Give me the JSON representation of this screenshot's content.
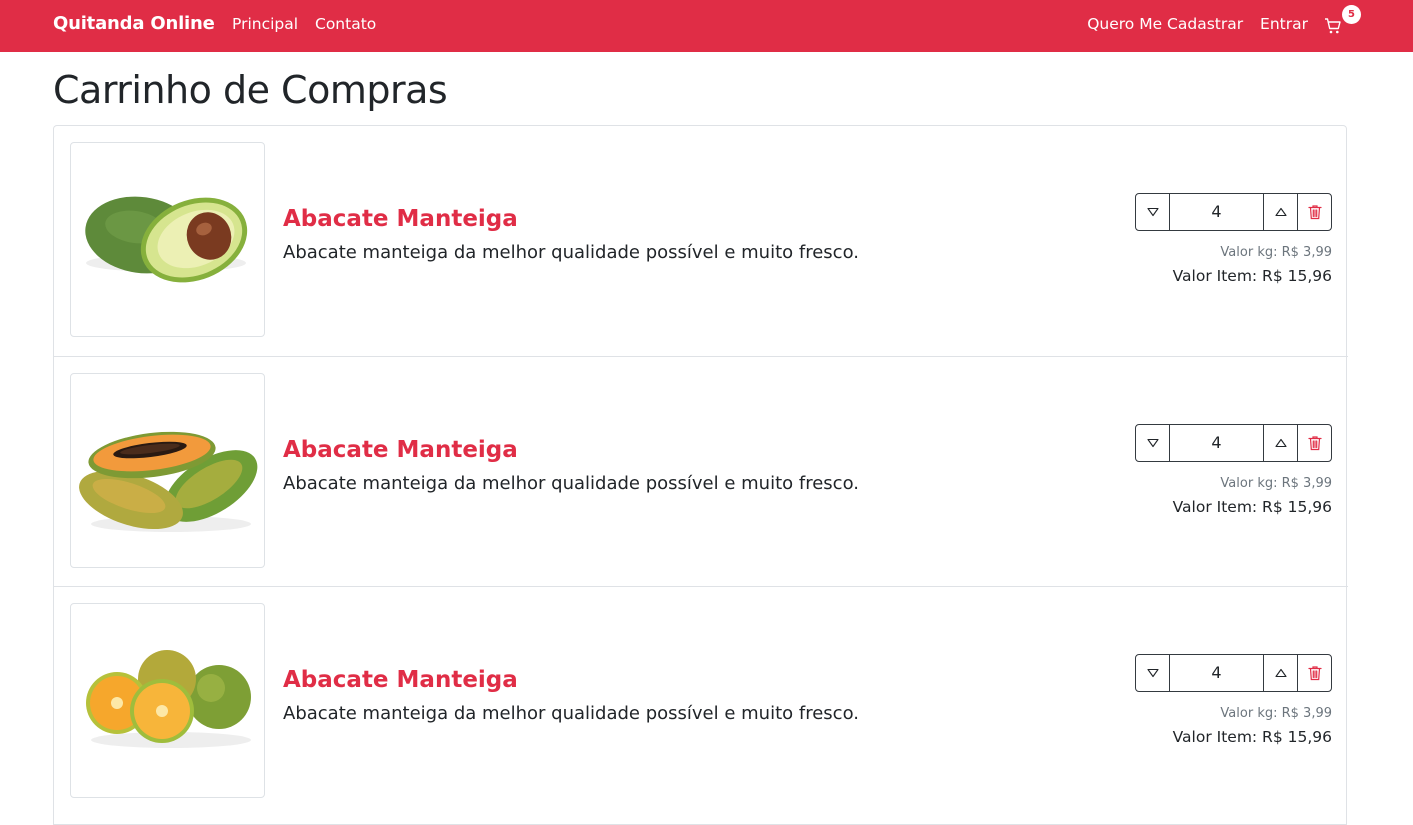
{
  "navbar": {
    "brand": "Quitanda Online",
    "links": [
      "Principal",
      "Contato"
    ],
    "register_label": "Quero Me Cadastrar",
    "login_label": "Entrar",
    "cart_count": "5"
  },
  "page": {
    "title": "Carrinho de Compras"
  },
  "cart": {
    "items": [
      {
        "name": "Abacate Manteiga",
        "description": "Abacate manteiga da melhor qualidade possível e muito fresco.",
        "quantity": "4",
        "price_kg": "Valor kg: R$ 3,99",
        "item_total": "Valor Item: R$ 15,96",
        "image": "avocado-image"
      },
      {
        "name": "Abacate Manteiga",
        "description": "Abacate manteiga da melhor qualidade possível e muito fresco.",
        "quantity": "4",
        "price_kg": "Valor kg: R$ 3,99",
        "item_total": "Valor Item: R$ 15,96",
        "image": "papaya-image"
      },
      {
        "name": "Abacate Manteiga",
        "description": "Abacate manteiga da melhor qualidade possível e muito fresco.",
        "quantity": "4",
        "price_kg": "Valor kg: R$ 3,99",
        "item_total": "Valor Item: R$ 15,96",
        "image": "orange-image"
      }
    ]
  },
  "icons": {
    "cart": "cart-icon",
    "decrease": "triangle-down-icon",
    "increase": "triangle-up-icon",
    "delete": "trash-icon"
  },
  "colors": {
    "brand_red": "#e02d46",
    "border": "#dfe2e6",
    "muted": "#6c757d"
  }
}
